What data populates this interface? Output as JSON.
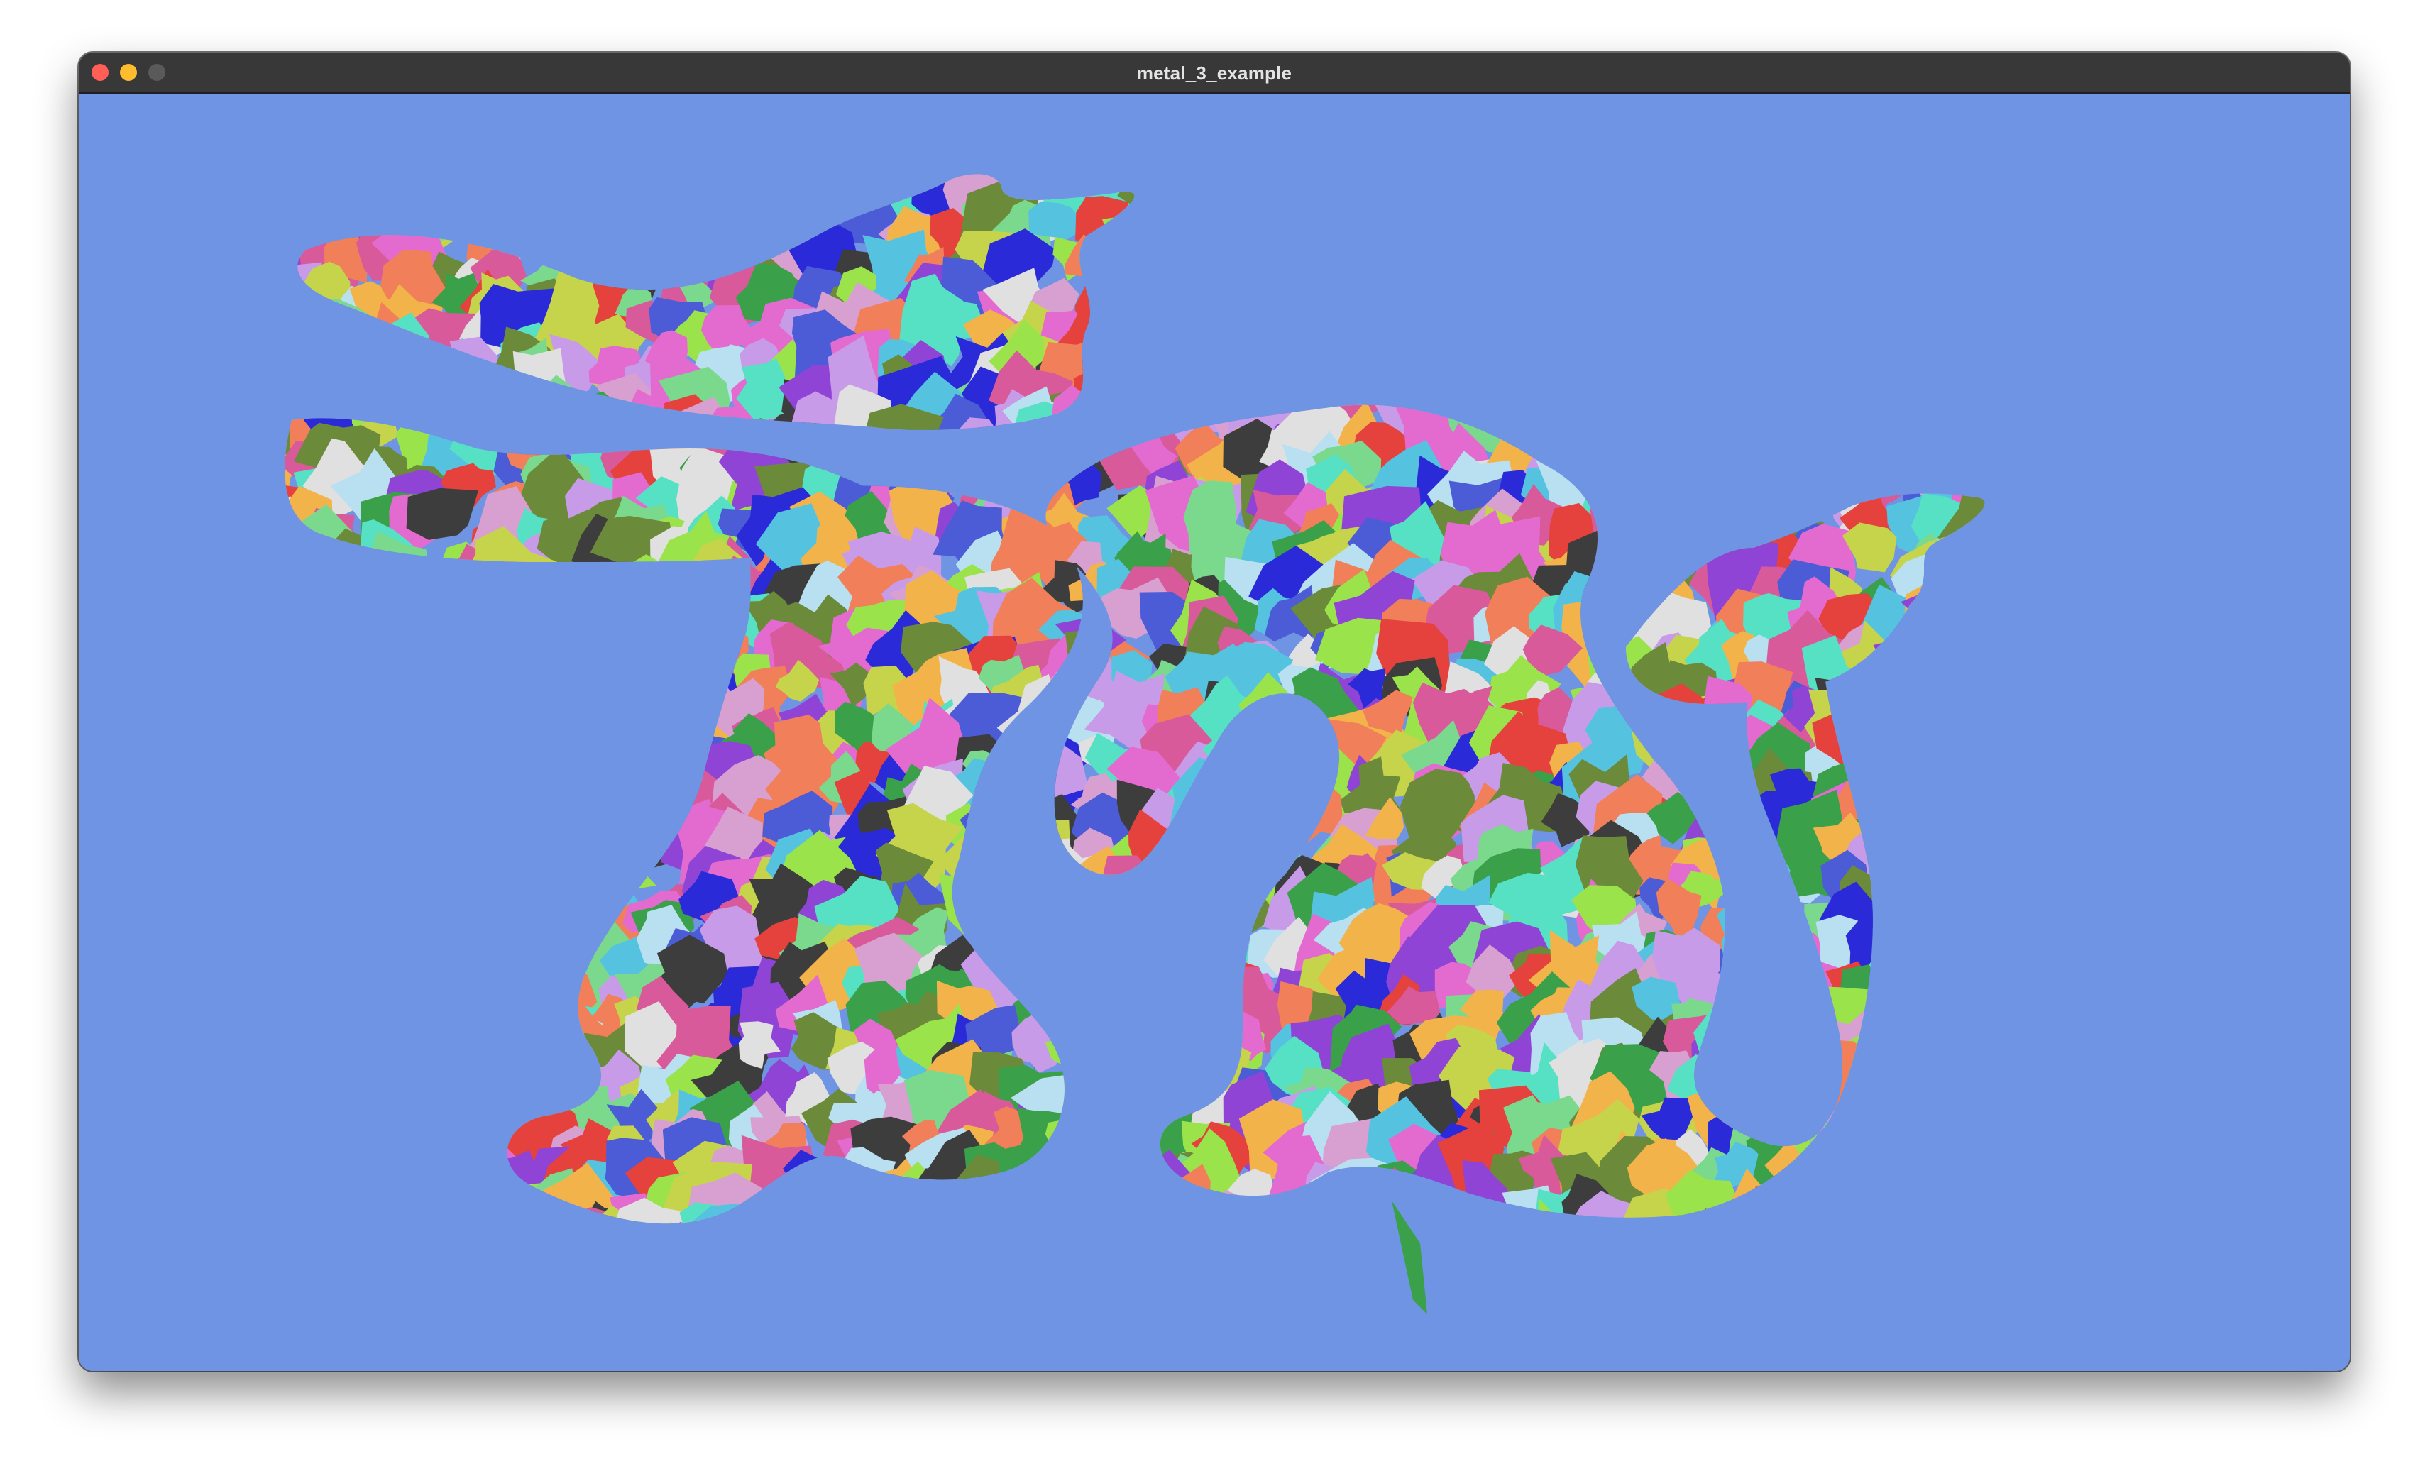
{
  "window": {
    "title": "metal_3_example",
    "buttons": {
      "close": "close-button",
      "minimize": "minimize-button",
      "zoom": "zoom-button"
    }
  },
  "viewport": {
    "clear_color": "#6f94e3",
    "content": "dragon-mesh-meshlets",
    "palette": [
      "#e5413d",
      "#8f44d6",
      "#55c3e0",
      "#9be34a",
      "#e36bcf",
      "#3aa04a",
      "#f2b44a",
      "#4c5bd6",
      "#d85a9b",
      "#7ad98c",
      "#c89be8",
      "#3d3d3d",
      "#f07f5a",
      "#56e0c4",
      "#c5d44a",
      "#2a2ad8",
      "#b8e0f0",
      "#6b8a3a",
      "#e0e0e0",
      "#d7a0d0"
    ]
  }
}
